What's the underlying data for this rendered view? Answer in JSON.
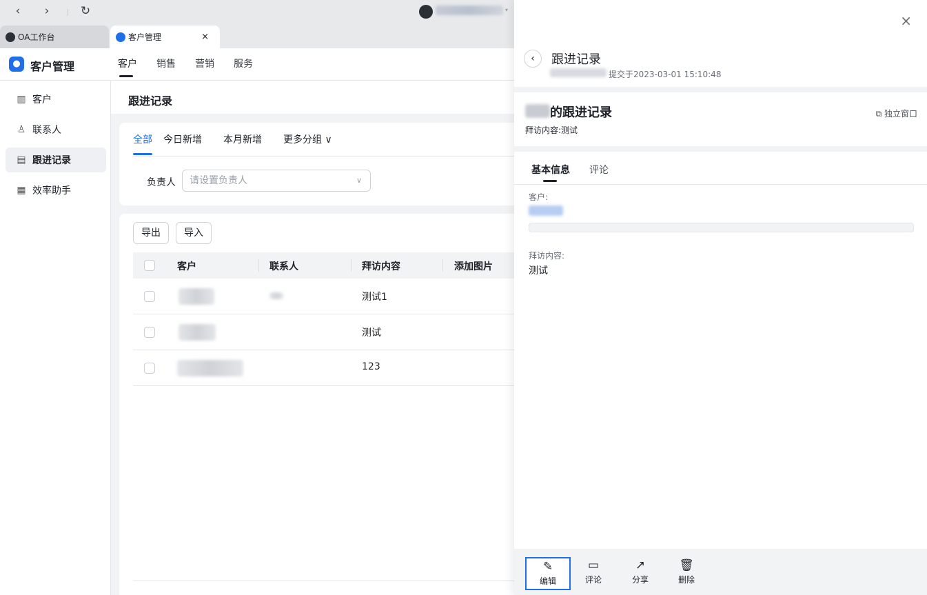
{
  "browser": {
    "nav": {
      "back": "‹",
      "forward": "›",
      "reload": "↻"
    },
    "tabs": [
      {
        "label": "OA工作台"
      },
      {
        "label": "客户管理",
        "close": "×"
      }
    ]
  },
  "app": {
    "title": "客户管理",
    "top_nav": [
      "客户",
      "销售",
      "营销",
      "服务"
    ],
    "sidebar": [
      {
        "label": "客户",
        "icon": "building-icon"
      },
      {
        "label": "联系人",
        "icon": "contact-icon"
      },
      {
        "label": "跟进记录",
        "icon": "note-icon"
      },
      {
        "label": "效率助手",
        "icon": "grid-icon"
      }
    ]
  },
  "main": {
    "page_title": "跟进记录",
    "filter_tabs": [
      "全部",
      "今日新增",
      "本月新增",
      "更多分组 ∨"
    ],
    "owner_label": "负责人",
    "owner_placeholder": "请设置负责人",
    "buttons": {
      "export": "导出",
      "import": "导入"
    },
    "columns": [
      "客户",
      "联系人",
      "拜访内容",
      "添加图片"
    ],
    "rows": [
      {
        "visit": "测试1"
      },
      {
        "visit": "测试"
      },
      {
        "visit": "123"
      }
    ]
  },
  "drawer": {
    "close": "×",
    "back": "‹",
    "title": "跟进记录",
    "submitted": "提交于2023-03-01 15:10:48",
    "record_title": "的跟进记录",
    "record_summary": "拜访内容:测试",
    "popout": "独立窗口",
    "tabs": [
      "基本信息",
      "评论"
    ],
    "fields": {
      "customer_label": "客户:",
      "visit_label": "拜访内容:",
      "visit_value": "测试"
    },
    "actions": [
      {
        "label": "编辑",
        "icon": "edit-icon",
        "glyph": "✎"
      },
      {
        "label": "评论",
        "icon": "comment-icon",
        "glyph": "▭"
      },
      {
        "label": "分享",
        "icon": "share-icon",
        "glyph": "↗"
      },
      {
        "label": "删除",
        "icon": "trash-icon",
        "glyph": "🗑"
      }
    ]
  },
  "colors": {
    "accent": "#1f6fe8"
  }
}
